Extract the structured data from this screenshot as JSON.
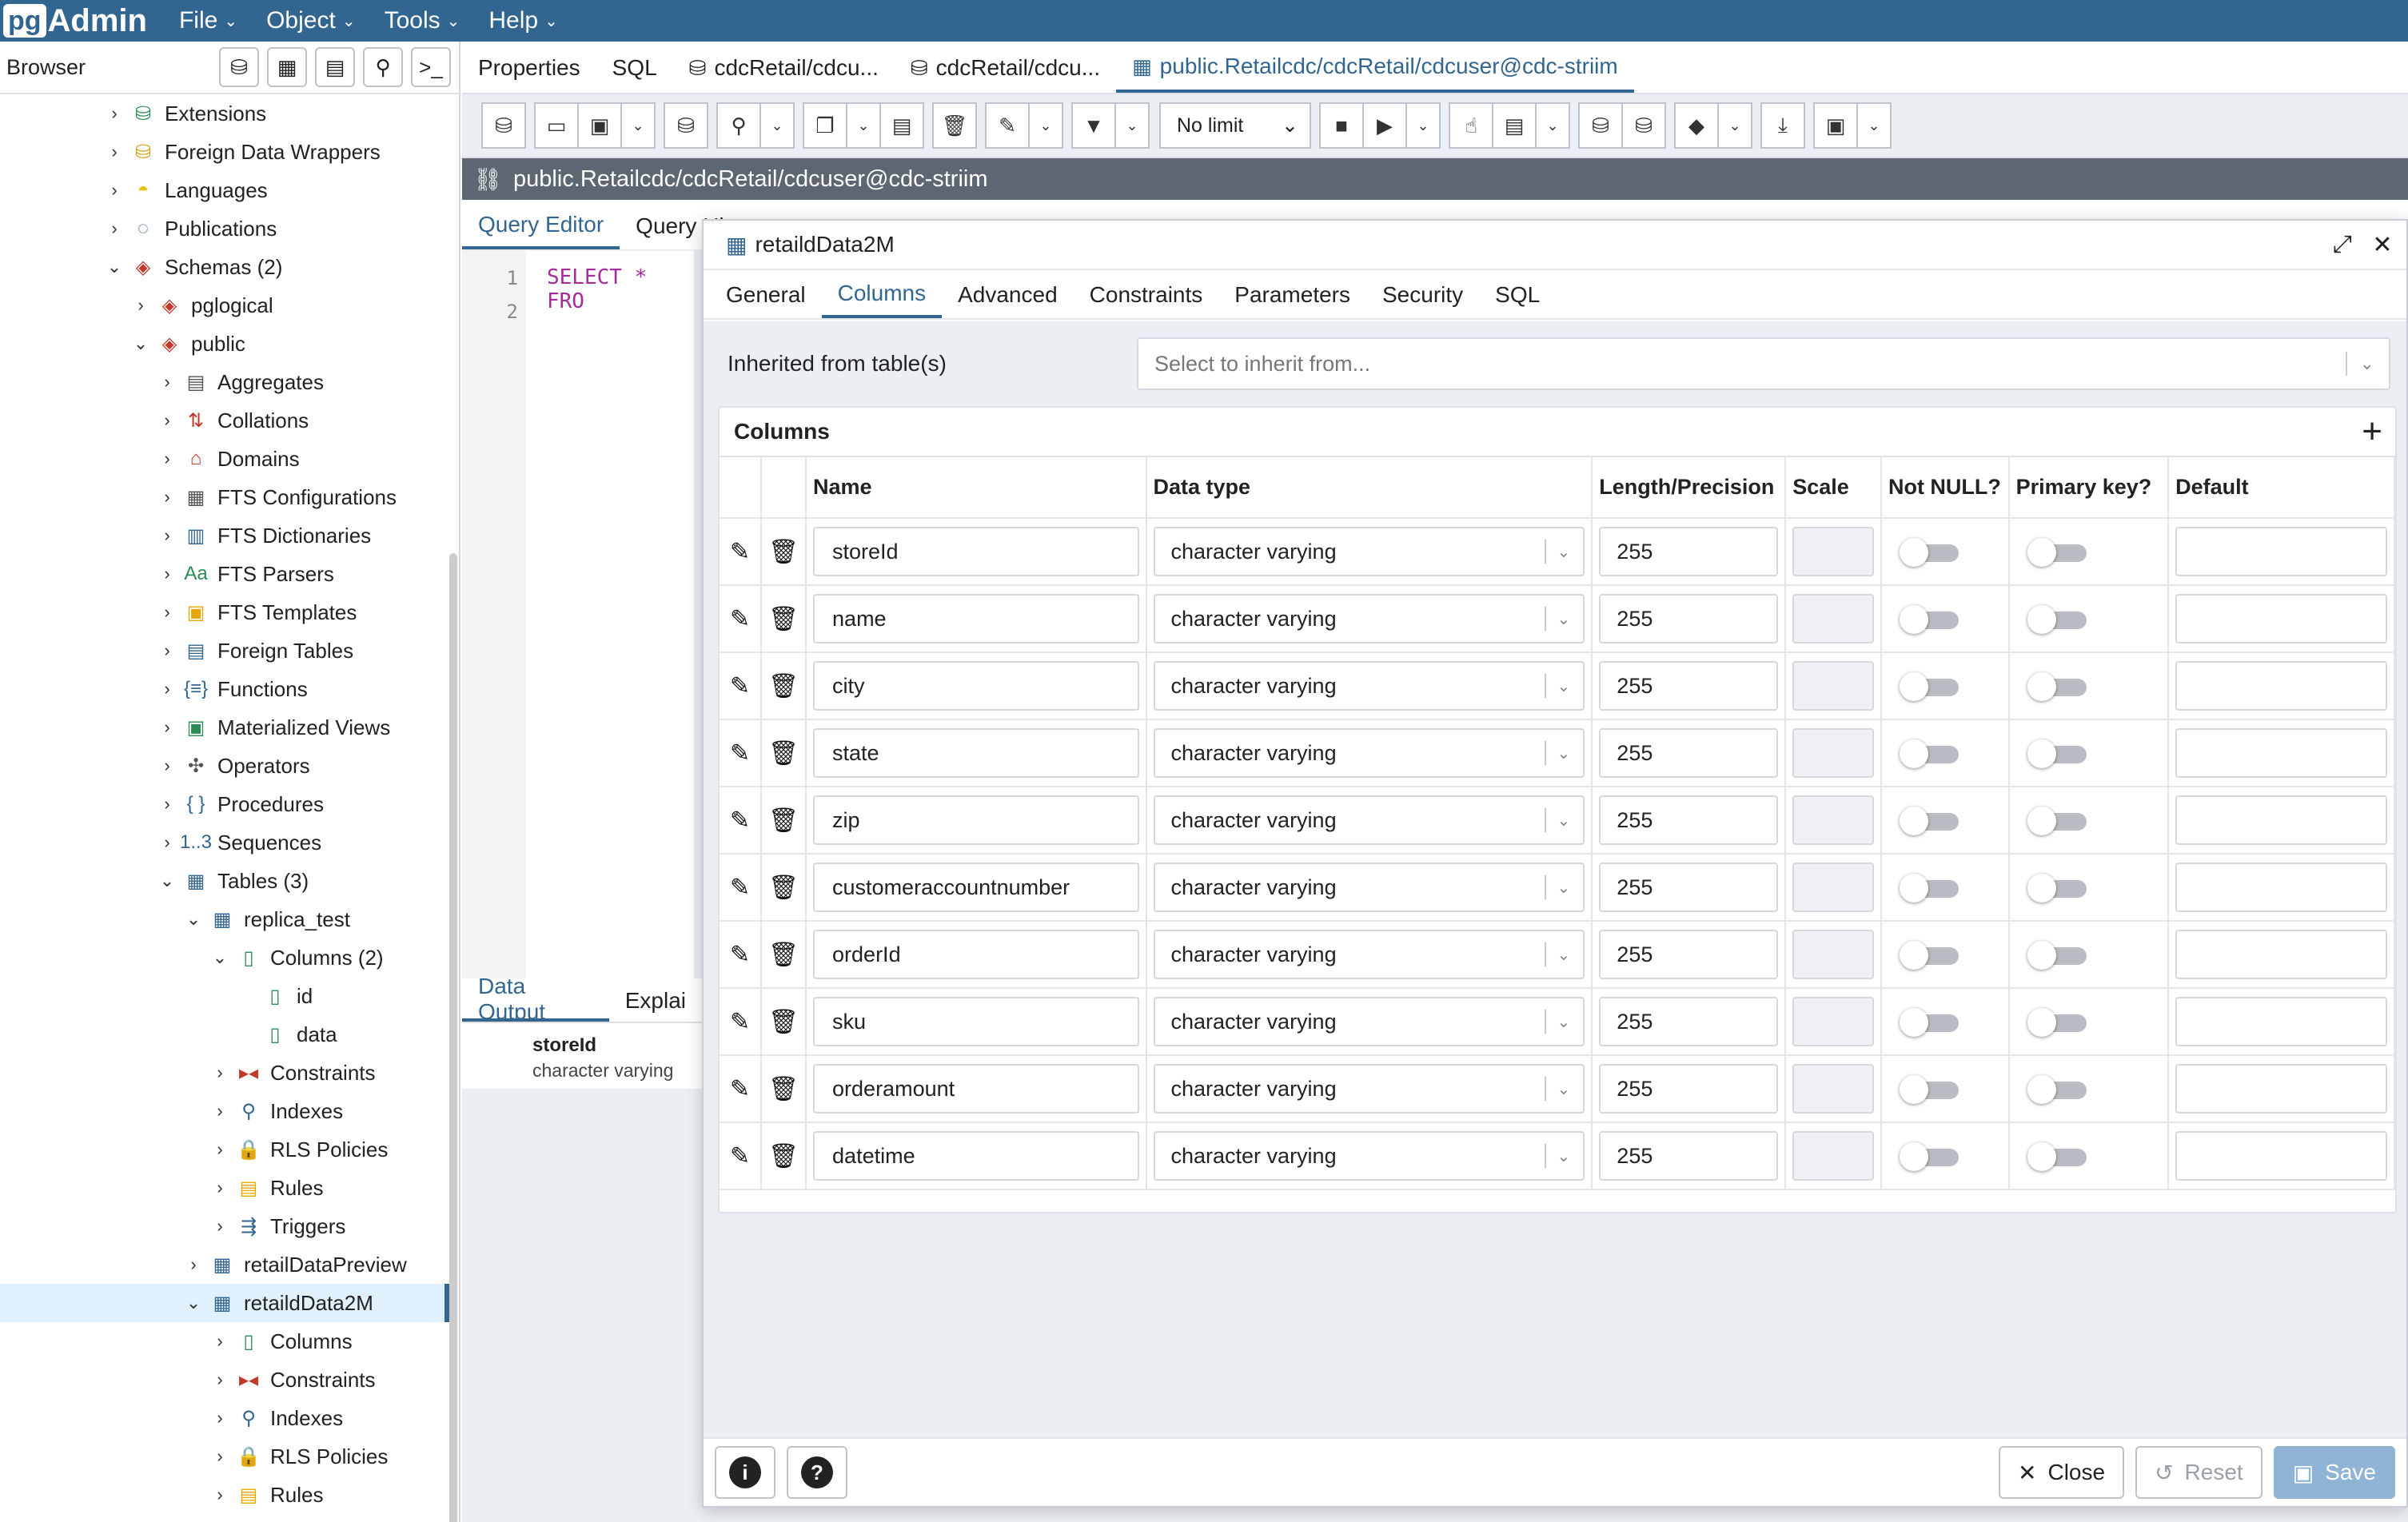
{
  "app": {
    "logo_pg": "pg",
    "logo_admin": "Admin"
  },
  "menu": [
    "File",
    "Object",
    "Tools",
    "Help"
  ],
  "browser": {
    "title": "Browser"
  },
  "tree": [
    {
      "label": "Extensions",
      "depth": 0,
      "toggle": "›",
      "icon": "extensions-icon",
      "glyph": "⛁",
      "color": "#2e8b57"
    },
    {
      "label": "Foreign Data Wrappers",
      "depth": 0,
      "toggle": "›",
      "icon": "foreign-data-wrapper-icon",
      "glyph": "⛁",
      "color": "#d4a017"
    },
    {
      "label": "Languages",
      "depth": 0,
      "toggle": "›",
      "icon": "language-icon",
      "glyph": "◓",
      "color": "#e6c300"
    },
    {
      "label": "Publications",
      "depth": 0,
      "toggle": "›",
      "icon": "publication-icon",
      "glyph": "◌",
      "color": "#326690"
    },
    {
      "label": "Schemas (2)",
      "depth": 0,
      "toggle": "⌄",
      "icon": "schemas-icon",
      "glyph": "◈",
      "color": "#c0392b"
    },
    {
      "label": "pglogical",
      "depth": 1,
      "toggle": "›",
      "icon": "schema-icon",
      "glyph": "◈",
      "color": "#c0392b"
    },
    {
      "label": "public",
      "depth": 1,
      "toggle": "⌄",
      "icon": "schema-icon",
      "glyph": "◈",
      "color": "#c0392b"
    },
    {
      "label": "Aggregates",
      "depth": 2,
      "toggle": "›",
      "icon": "aggregates-icon",
      "glyph": "▤",
      "color": "#555"
    },
    {
      "label": "Collations",
      "depth": 2,
      "toggle": "›",
      "icon": "collations-icon",
      "glyph": "⇅",
      "color": "#c0392b"
    },
    {
      "label": "Domains",
      "depth": 2,
      "toggle": "›",
      "icon": "domains-icon",
      "glyph": "⌂",
      "color": "#c0392b"
    },
    {
      "label": "FTS Configurations",
      "depth": 2,
      "toggle": "›",
      "icon": "fts-configuration-icon",
      "glyph": "▦",
      "color": "#555"
    },
    {
      "label": "FTS Dictionaries",
      "depth": 2,
      "toggle": "›",
      "icon": "fts-dictionary-icon",
      "glyph": "▥",
      "color": "#326690"
    },
    {
      "label": "FTS Parsers",
      "depth": 2,
      "toggle": "›",
      "icon": "fts-parser-icon",
      "glyph": "Aa",
      "color": "#2e8b57"
    },
    {
      "label": "FTS Templates",
      "depth": 2,
      "toggle": "›",
      "icon": "fts-template-icon",
      "glyph": "▣",
      "color": "#e6a800"
    },
    {
      "label": "Foreign Tables",
      "depth": 2,
      "toggle": "›",
      "icon": "foreign-table-icon",
      "glyph": "▤",
      "color": "#326690"
    },
    {
      "label": "Functions",
      "depth": 2,
      "toggle": "›",
      "icon": "functions-icon",
      "glyph": "{≡}",
      "color": "#326690"
    },
    {
      "label": "Materialized Views",
      "depth": 2,
      "toggle": "›",
      "icon": "materialized-view-icon",
      "glyph": "▣",
      "color": "#2e8b57"
    },
    {
      "label": "Operators",
      "depth": 2,
      "toggle": "›",
      "icon": "operators-icon",
      "glyph": "✣",
      "color": "#555"
    },
    {
      "label": "Procedures",
      "depth": 2,
      "toggle": "›",
      "icon": "procedures-icon",
      "glyph": "{ }",
      "color": "#326690"
    },
    {
      "label": "Sequences",
      "depth": 2,
      "toggle": "›",
      "icon": "sequences-icon",
      "glyph": "1..3",
      "color": "#326690"
    },
    {
      "label": "Tables (3)",
      "depth": 2,
      "toggle": "⌄",
      "icon": "tables-icon",
      "glyph": "▦",
      "color": "#326690"
    },
    {
      "label": "replica_test",
      "depth": 3,
      "toggle": "⌄",
      "icon": "table-icon",
      "glyph": "▦",
      "color": "#326690"
    },
    {
      "label": "Columns (2)",
      "depth": 4,
      "toggle": "⌄",
      "icon": "columns-icon",
      "glyph": "▯",
      "color": "#2e8b57"
    },
    {
      "label": "id",
      "depth": 5,
      "toggle": "",
      "icon": "column-icon",
      "glyph": "▯",
      "color": "#2e8b57"
    },
    {
      "label": "data",
      "depth": 5,
      "toggle": "",
      "icon": "column-icon",
      "glyph": "▯",
      "color": "#2e8b57"
    },
    {
      "label": "Constraints",
      "depth": 4,
      "toggle": "›",
      "icon": "constraints-icon",
      "glyph": "▸◂",
      "color": "#c0392b"
    },
    {
      "label": "Indexes",
      "depth": 4,
      "toggle": "›",
      "icon": "indexes-icon",
      "glyph": "⚲",
      "color": "#326690"
    },
    {
      "label": "RLS Policies",
      "depth": 4,
      "toggle": "›",
      "icon": "rls-policy-icon",
      "glyph": "🔒",
      "color": "#2e8b57"
    },
    {
      "label": "Rules",
      "depth": 4,
      "toggle": "›",
      "icon": "rules-icon",
      "glyph": "▤",
      "color": "#e6a800"
    },
    {
      "label": "Triggers",
      "depth": 4,
      "toggle": "›",
      "icon": "triggers-icon",
      "glyph": "⇶",
      "color": "#326690"
    },
    {
      "label": "retailDataPreview",
      "depth": 3,
      "toggle": "›",
      "icon": "table-icon",
      "glyph": "▦",
      "color": "#326690"
    },
    {
      "label": "retaildData2M",
      "depth": 3,
      "toggle": "⌄",
      "icon": "table-icon",
      "glyph": "▦",
      "color": "#326690",
      "selected": true
    },
    {
      "label": "Columns",
      "depth": 4,
      "toggle": "›",
      "icon": "columns-icon",
      "glyph": "▯",
      "color": "#2e8b57"
    },
    {
      "label": "Constraints",
      "depth": 4,
      "toggle": "›",
      "icon": "constraints-icon",
      "glyph": "▸◂",
      "color": "#c0392b"
    },
    {
      "label": "Indexes",
      "depth": 4,
      "toggle": "›",
      "icon": "indexes-icon",
      "glyph": "⚲",
      "color": "#326690"
    },
    {
      "label": "RLS Policies",
      "depth": 4,
      "toggle": "›",
      "icon": "rls-policy-icon",
      "glyph": "🔒",
      "color": "#2e8b57"
    },
    {
      "label": "Rules",
      "depth": 4,
      "toggle": "›",
      "icon": "rules-icon",
      "glyph": "▤",
      "color": "#e6a800"
    }
  ],
  "tabs": [
    {
      "label": "Properties",
      "icon": ""
    },
    {
      "label": "SQL",
      "icon": ""
    },
    {
      "label": "cdcRetail/cdcu...",
      "icon": "⛁"
    },
    {
      "label": "cdcRetail/cdcu...",
      "icon": "⛁"
    },
    {
      "label": "public.Retailcdc/cdcRetail/cdcuser@cdc-striim",
      "icon": "▦",
      "active": true
    }
  ],
  "toolbar": {
    "limit": "No limit"
  },
  "connection": {
    "label": "public.Retailcdc/cdcRetail/cdcuser@cdc-striim"
  },
  "query_tabs": [
    "Query Editor",
    "Query History"
  ],
  "editor": {
    "line1_no": "1",
    "line2_no": "2",
    "line1_code": "SELECT * FRO"
  },
  "output": {
    "tabs": [
      "Data Output",
      "Explai"
    ],
    "col_name": "storeId",
    "col_type": "character varying"
  },
  "dialog": {
    "title": "retaildData2M",
    "tabs": [
      "General",
      "Columns",
      "Advanced",
      "Constraints",
      "Parameters",
      "Security",
      "SQL"
    ],
    "active_tab": 1,
    "inherit_label": "Inherited from table(s)",
    "inherit_placeholder": "Select to inherit from...",
    "columns_title": "Columns",
    "headers": {
      "name": "Name",
      "type": "Data type",
      "length": "Length/Precision",
      "scale": "Scale",
      "notnull": "Not NULL?",
      "pk": "Primary key?",
      "default": "Default"
    },
    "rows": [
      {
        "name": "storeId",
        "type": "character varying",
        "length": "255"
      },
      {
        "name": "name",
        "type": "character varying",
        "length": "255"
      },
      {
        "name": "city",
        "type": "character varying",
        "length": "255"
      },
      {
        "name": "state",
        "type": "character varying",
        "length": "255"
      },
      {
        "name": "zip",
        "type": "character varying",
        "length": "255"
      },
      {
        "name": "customeraccountnumber",
        "type": "character varying",
        "length": "255"
      },
      {
        "name": "orderId",
        "type": "character varying",
        "length": "255"
      },
      {
        "name": "sku",
        "type": "character varying",
        "length": "255"
      },
      {
        "name": "orderamount",
        "type": "character varying",
        "length": "255"
      },
      {
        "name": "datetime",
        "type": "character varying",
        "length": "255"
      }
    ],
    "footer": {
      "close": "Close",
      "reset": "Reset",
      "save": "Save"
    }
  }
}
